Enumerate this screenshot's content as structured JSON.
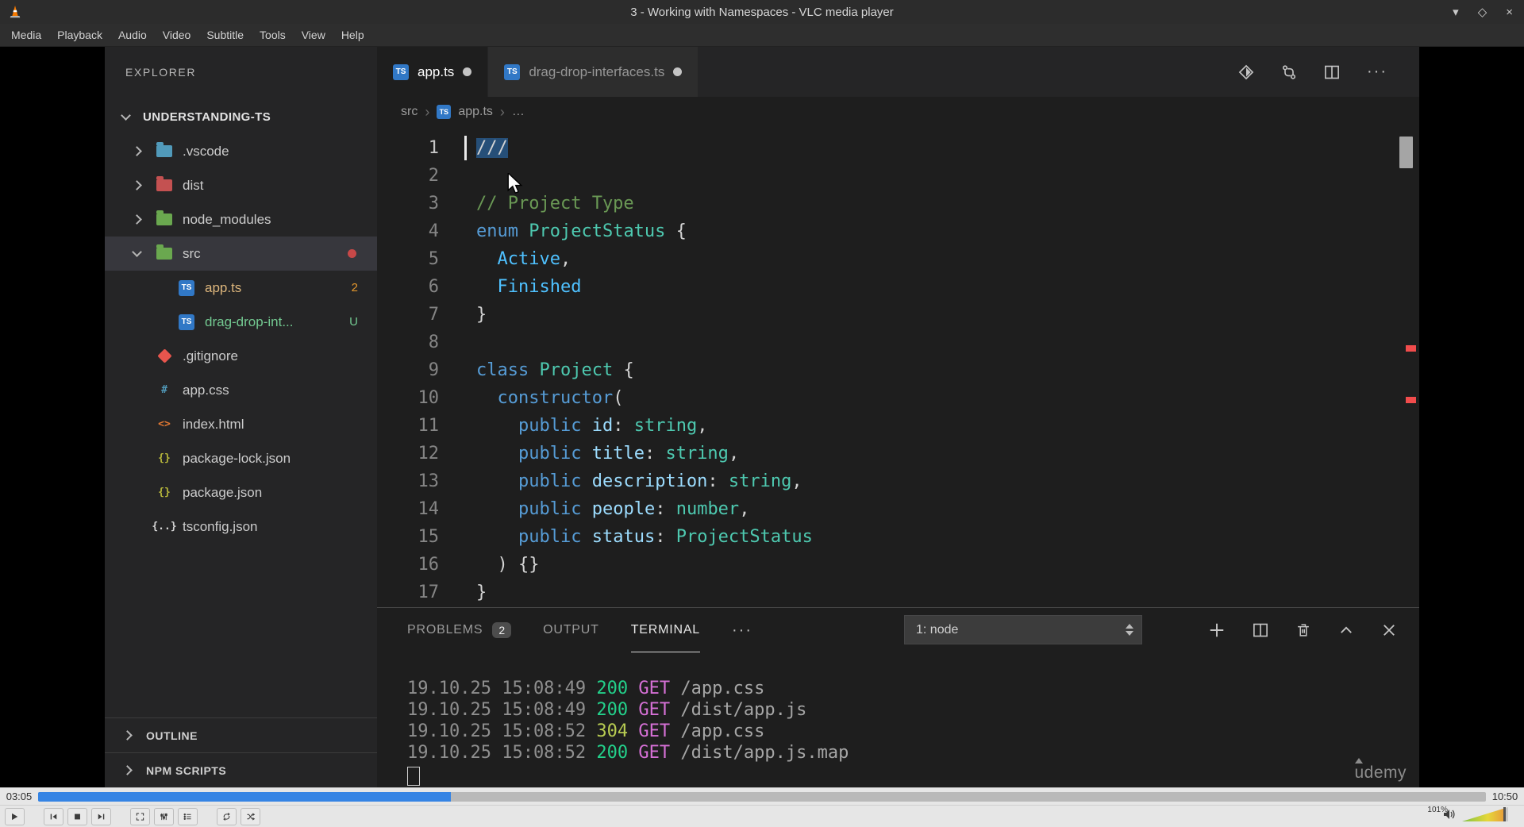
{
  "window": {
    "title": "3 - Working with Namespaces - VLC media player",
    "menu": [
      "Media",
      "Playback",
      "Audio",
      "Video",
      "Subtitle",
      "Tools",
      "View",
      "Help"
    ],
    "controls": {
      "minimize": "▾",
      "maximize": "◇",
      "close": "×"
    }
  },
  "player": {
    "elapsed": "03:05",
    "total": "10:50",
    "progress_percent": 28.5,
    "volume_label": "101%",
    "controls": [
      "play",
      "previous",
      "stop",
      "next",
      "fullscreen",
      "extended-settings",
      "playlist",
      "loop",
      "random"
    ],
    "accent_color": "#3584e4"
  },
  "vscode": {
    "explorer_title": "EXPLORER",
    "workspace": "UNDERSTANDING-TS",
    "tree": [
      {
        "label": ".vscode",
        "kind": "folder",
        "icon_color": "#519aba",
        "level": 1
      },
      {
        "label": "dist",
        "kind": "folder",
        "icon_color": "#c45151",
        "level": 1
      },
      {
        "label": "node_modules",
        "kind": "folder",
        "icon_color": "#6aa84f",
        "level": 1
      },
      {
        "label": "src",
        "kind": "folder",
        "icon_color": "#6aa84f",
        "level": 1,
        "expanded": true,
        "selected": true,
        "modified_dot": true
      },
      {
        "label": "app.ts",
        "kind": "file",
        "icon": "ts",
        "level": 2,
        "label_color": "#ddb67c",
        "badge": "2",
        "badge_color": "#e2962d"
      },
      {
        "label": "drag-drop-int...",
        "kind": "file",
        "icon": "ts",
        "level": 2,
        "label_color": "#73c991",
        "badge": "U",
        "badge_color": "#73c991"
      },
      {
        "label": ".gitignore",
        "kind": "file",
        "icon": "git",
        "level": 1
      },
      {
        "label": "app.css",
        "kind": "file",
        "icon": "css",
        "level": 1
      },
      {
        "label": "index.html",
        "kind": "file",
        "icon": "html",
        "level": 1
      },
      {
        "label": "package-lock.json",
        "kind": "file",
        "icon": "json",
        "level": 1
      },
      {
        "label": "package.json",
        "kind": "file",
        "icon": "json",
        "level": 1
      },
      {
        "label": "tsconfig.json",
        "kind": "file",
        "icon": "tsconfig",
        "level": 1
      }
    ],
    "bottom_sections": [
      "OUTLINE",
      "NPM SCRIPTS"
    ],
    "tabs": [
      {
        "label": "app.ts",
        "active": true,
        "modified": true
      },
      {
        "label": "drag-drop-interfaces.ts",
        "active": false,
        "modified": true
      }
    ],
    "editor_actions": [
      "open-changes",
      "git-compare",
      "split-editor",
      "more-actions"
    ],
    "breadcrumb": [
      {
        "label": "src"
      },
      {
        "label": "app.ts",
        "icon": "ts"
      },
      {
        "label": "…"
      }
    ],
    "code": {
      "selection_color": "#264f78",
      "lines": [
        {
          "n": 1,
          "cursor": true,
          "tokens": [
            {
              "t": "///",
              "c": "fg",
              "sel": true
            }
          ]
        },
        {
          "n": 2,
          "tokens": []
        },
        {
          "n": 3,
          "tokens": [
            {
              "t": "// Project Type",
              "c": "com"
            }
          ]
        },
        {
          "n": 4,
          "tokens": [
            {
              "t": "enum",
              "c": "kw"
            },
            {
              "t": " ",
              "c": "fg"
            },
            {
              "t": "ProjectStatus",
              "c": "type"
            },
            {
              "t": " {",
              "c": "fg"
            }
          ]
        },
        {
          "n": 5,
          "tokens": [
            {
              "t": "  ",
              "c": "fg"
            },
            {
              "t": "Active",
              "c": "enumm"
            },
            {
              "t": ",",
              "c": "fg"
            }
          ]
        },
        {
          "n": 6,
          "tokens": [
            {
              "t": "  ",
              "c": "fg"
            },
            {
              "t": "Finished",
              "c": "enumm"
            }
          ]
        },
        {
          "n": 7,
          "tokens": [
            {
              "t": "}",
              "c": "fg"
            }
          ]
        },
        {
          "n": 8,
          "tokens": []
        },
        {
          "n": 9,
          "tokens": [
            {
              "t": "class",
              "c": "kw"
            },
            {
              "t": " ",
              "c": "fg"
            },
            {
              "t": "Project",
              "c": "type"
            },
            {
              "t": " {",
              "c": "fg"
            }
          ]
        },
        {
          "n": 10,
          "tokens": [
            {
              "t": "  ",
              "c": "fg"
            },
            {
              "t": "constructor",
              "c": "kw"
            },
            {
              "t": "(",
              "c": "fg"
            }
          ]
        },
        {
          "n": 11,
          "tokens": [
            {
              "t": "    ",
              "c": "fg"
            },
            {
              "t": "public",
              "c": "kw"
            },
            {
              "t": " ",
              "c": "fg"
            },
            {
              "t": "id",
              "c": "var"
            },
            {
              "t": ": ",
              "c": "fg"
            },
            {
              "t": "string",
              "c": "type"
            },
            {
              "t": ",",
              "c": "fg"
            }
          ]
        },
        {
          "n": 12,
          "tokens": [
            {
              "t": "    ",
              "c": "fg"
            },
            {
              "t": "public",
              "c": "kw"
            },
            {
              "t": " ",
              "c": "fg"
            },
            {
              "t": "title",
              "c": "var"
            },
            {
              "t": ": ",
              "c": "fg"
            },
            {
              "t": "string",
              "c": "type"
            },
            {
              "t": ",",
              "c": "fg"
            }
          ]
        },
        {
          "n": 13,
          "tokens": [
            {
              "t": "    ",
              "c": "fg"
            },
            {
              "t": "public",
              "c": "kw"
            },
            {
              "t": " ",
              "c": "fg"
            },
            {
              "t": "description",
              "c": "var"
            },
            {
              "t": ": ",
              "c": "fg"
            },
            {
              "t": "string",
              "c": "type"
            },
            {
              "t": ",",
              "c": "fg"
            }
          ]
        },
        {
          "n": 14,
          "tokens": [
            {
              "t": "    ",
              "c": "fg"
            },
            {
              "t": "public",
              "c": "kw"
            },
            {
              "t": " ",
              "c": "fg"
            },
            {
              "t": "people",
              "c": "var"
            },
            {
              "t": ": ",
              "c": "fg"
            },
            {
              "t": "number",
              "c": "type"
            },
            {
              "t": ",",
              "c": "fg"
            }
          ]
        },
        {
          "n": 15,
          "tokens": [
            {
              "t": "    ",
              "c": "fg"
            },
            {
              "t": "public",
              "c": "kw"
            },
            {
              "t": " ",
              "c": "fg"
            },
            {
              "t": "status",
              "c": "var"
            },
            {
              "t": ": ",
              "c": "fg"
            },
            {
              "t": "ProjectStatus",
              "c": "type"
            }
          ]
        },
        {
          "n": 16,
          "tokens": [
            {
              "t": "  ) {}",
              "c": "fg"
            }
          ]
        },
        {
          "n": 17,
          "tokens": [
            {
              "t": "}",
              "c": "fg"
            }
          ]
        }
      ]
    },
    "panel": {
      "tabs": [
        {
          "label": "PROBLEMS",
          "badge": "2"
        },
        {
          "label": "OUTPUT"
        },
        {
          "label": "TERMINAL",
          "active": true
        }
      ],
      "more_label": "···",
      "shell_select": "1: node",
      "actions": [
        "new-terminal",
        "split-terminal",
        "kill-terminal",
        "panel-maximize",
        "panel-close"
      ],
      "terminal_lines": [
        {
          "time": "19.10.25 15:08:49",
          "status": "200",
          "method": "GET",
          "path": "/app.css"
        },
        {
          "time": "19.10.25 15:08:49",
          "status": "200",
          "method": "GET",
          "path": "/dist/app.js"
        },
        {
          "time": "19.10.25 15:08:52",
          "status": "304",
          "method": "GET",
          "path": "/app.css"
        },
        {
          "time": "19.10.25 15:08:52",
          "status": "200",
          "method": "GET",
          "path": "/dist/app.js.map"
        }
      ]
    },
    "watermark": "udemy"
  }
}
